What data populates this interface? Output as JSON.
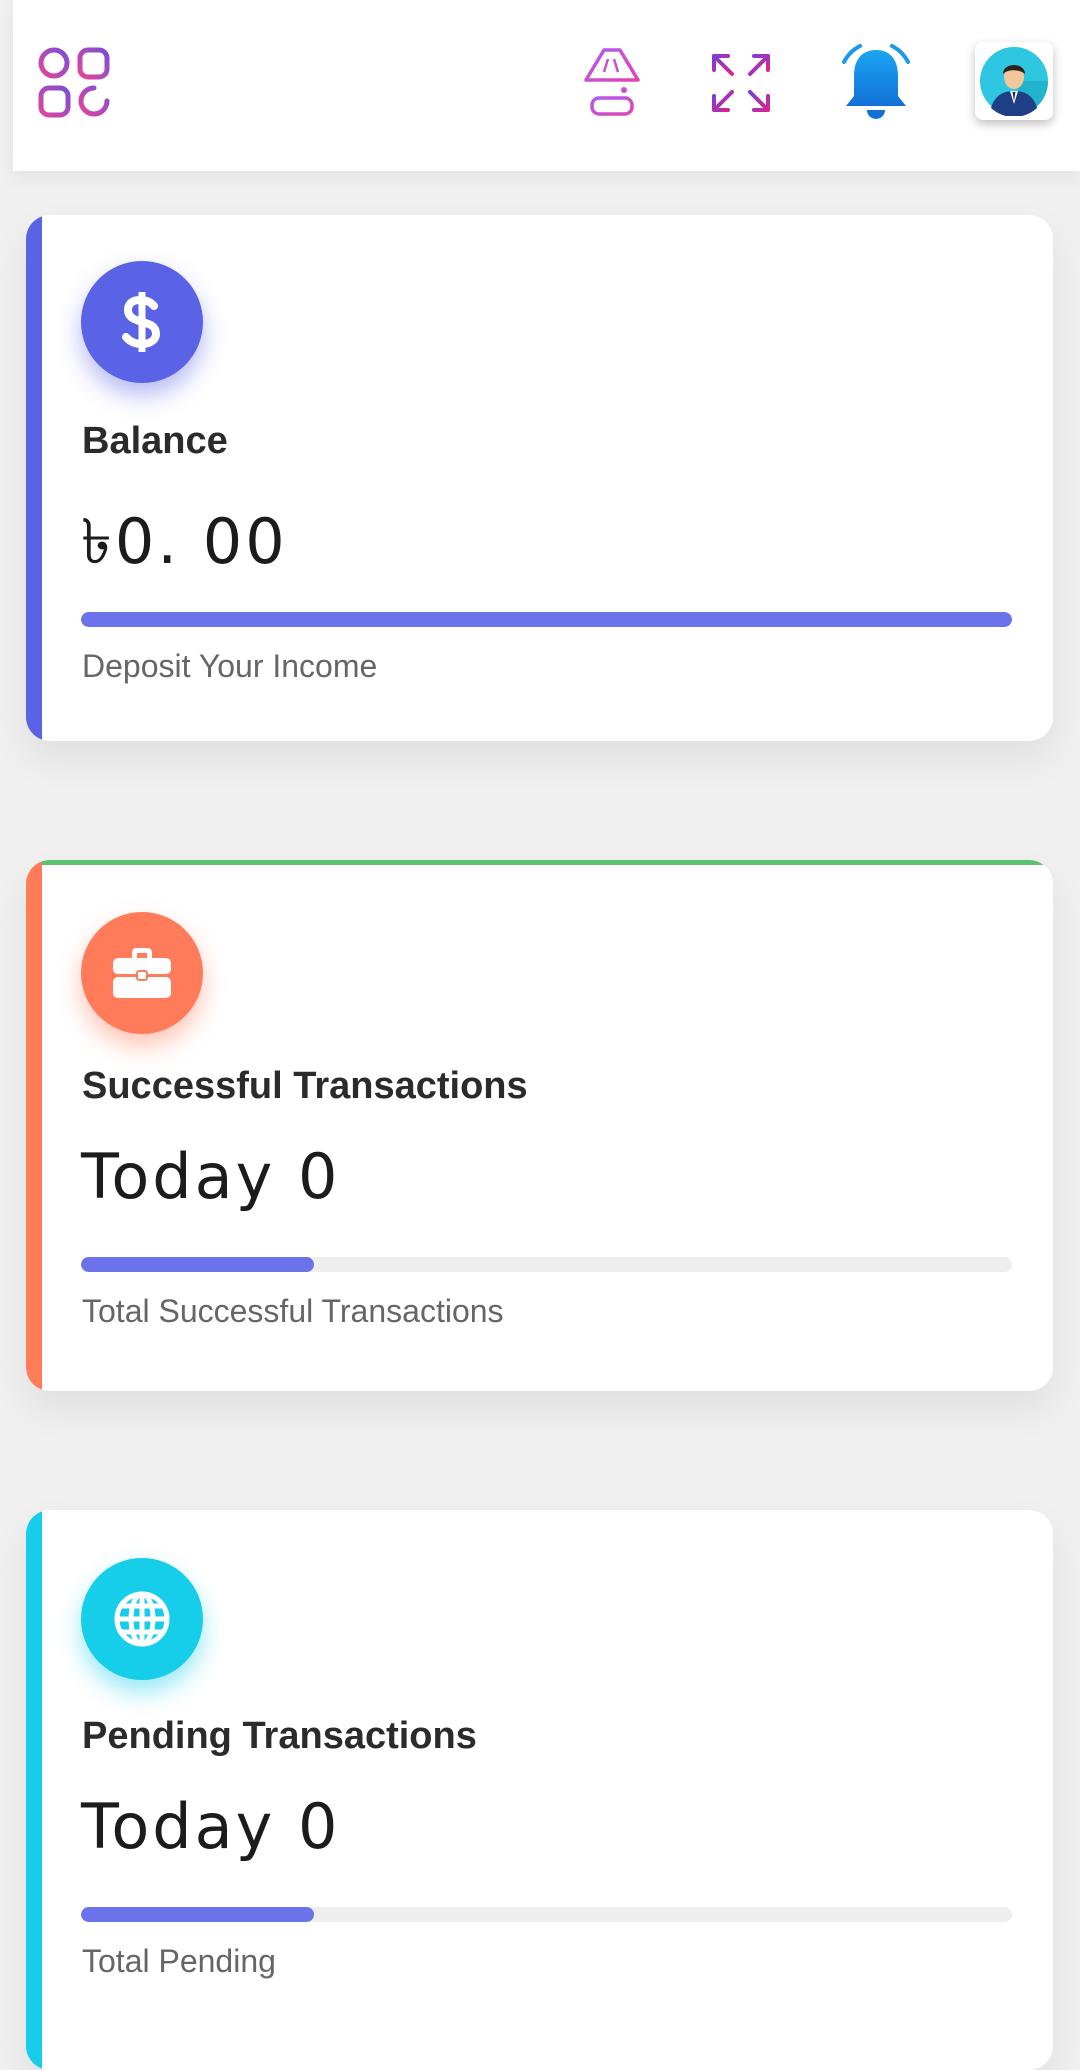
{
  "header": {
    "menu_icon": "apps-grid-icon",
    "theme_icon": "lamp-icon",
    "fullscreen_icon": "expand-arrows-icon",
    "notification_icon": "bell-icon",
    "avatar_icon": "user-avatar-icon"
  },
  "cards": [
    {
      "icon": "dollar-icon",
      "label": "Balance",
      "value": "৳0. 00",
      "caption": "Deposit Your Income",
      "progress_percent": 100,
      "accent_color": "#5a63e6",
      "icon_bg": "#5a63e6"
    },
    {
      "icon": "briefcase-icon",
      "label": "Successful Transactions",
      "value": "Today 0",
      "caption": "Total Successful Transactions",
      "progress_percent": 25,
      "accent_color": "#ff7b5a",
      "top_color": "#5cc26f",
      "icon_bg": "#ff7b5a"
    },
    {
      "icon": "globe-icon",
      "label": "Pending Transactions",
      "value": "Today 0",
      "caption": "Total Pending",
      "progress_percent": 25,
      "accent_color": "#16cdea",
      "icon_bg": "#16cdea"
    }
  ]
}
